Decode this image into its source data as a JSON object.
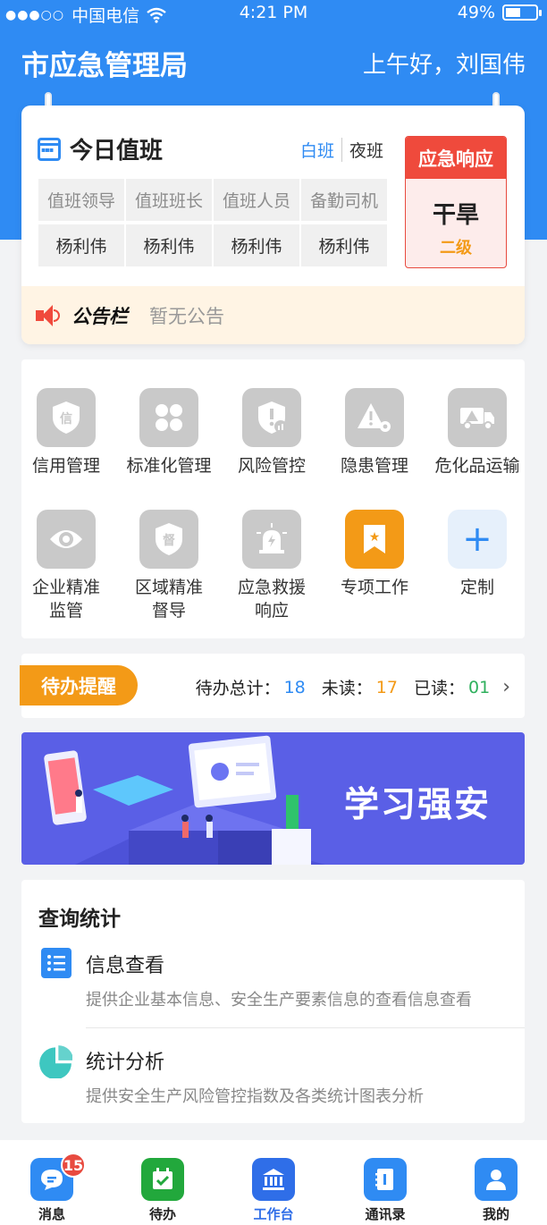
{
  "status_bar": {
    "carrier": "中国电信",
    "time": "4:21 PM",
    "battery": "49%",
    "battery_level": 0.49
  },
  "header": {
    "org": "市应急管理局",
    "greeting": "上午好，刘国伟"
  },
  "duty": {
    "title": "今日值班",
    "tab_day": "白班",
    "tab_night": "夜班",
    "roles": [
      "值班领导",
      "值班班长",
      "值班人员",
      "备勤司机"
    ],
    "names": [
      "杨利伟",
      "杨利伟",
      "杨利伟",
      "杨利伟"
    ],
    "response": {
      "header": "应急响应",
      "type": "干旱",
      "level": "二级"
    }
  },
  "notice": {
    "label": "公告栏",
    "text": "暂无公告"
  },
  "apps": [
    {
      "label": "信用管理",
      "glyph": "信",
      "icon": "credit-shield-icon"
    },
    {
      "label": "标准化管理",
      "glyph": "",
      "icon": "grid-four-icon"
    },
    {
      "label": "风险管控",
      "glyph": "!",
      "icon": "risk-shield-icon"
    },
    {
      "label": "隐患管理",
      "glyph": "⚠",
      "icon": "hazard-warning-icon"
    },
    {
      "label": "危化品运输",
      "glyph": "⚠",
      "icon": "hazmat-truck-icon"
    },
    {
      "label": "企业精准\n监管",
      "glyph": "",
      "icon": "eye-icon"
    },
    {
      "label": "区域精准\n督导",
      "glyph": "督",
      "icon": "supervise-shield-icon"
    },
    {
      "label": "应急救援\n响应",
      "glyph": "",
      "icon": "alarm-light-icon"
    },
    {
      "label": "专项工作",
      "glyph": "★",
      "icon": "bookmark-star-icon"
    },
    {
      "label": "定制",
      "glyph": "+",
      "icon": "plus-icon"
    }
  ],
  "todo": {
    "tag": "待办提醒",
    "total_label": "待办总计：",
    "total": "18",
    "unread_label": "未读：",
    "unread": "17",
    "read_label": "已读：",
    "read": "01"
  },
  "banner": {
    "text": "学习强安"
  },
  "query": {
    "title": "查询统计",
    "items": [
      {
        "name": "信息查看",
        "desc": "提供企业基本信息、安全生产要素信息的查看信息查看"
      },
      {
        "name": "统计分析",
        "desc": "提供安全生产风险管控指数及各类统计图表分析"
      }
    ]
  },
  "tabs": [
    {
      "label": "消息",
      "badge": "15",
      "color": "#2f8bf3"
    },
    {
      "label": "待办",
      "color": "#22a83c"
    },
    {
      "label": "工作台",
      "color": "#2f6ee8"
    },
    {
      "label": "通讯录",
      "color": "#2f8bf3"
    },
    {
      "label": "我的",
      "color": "#2f8bf3"
    }
  ],
  "colors": {
    "primary": "#2f8bf3",
    "warning": "#f39a17",
    "danger": "#ef4a3c",
    "success": "#2fb05d"
  }
}
